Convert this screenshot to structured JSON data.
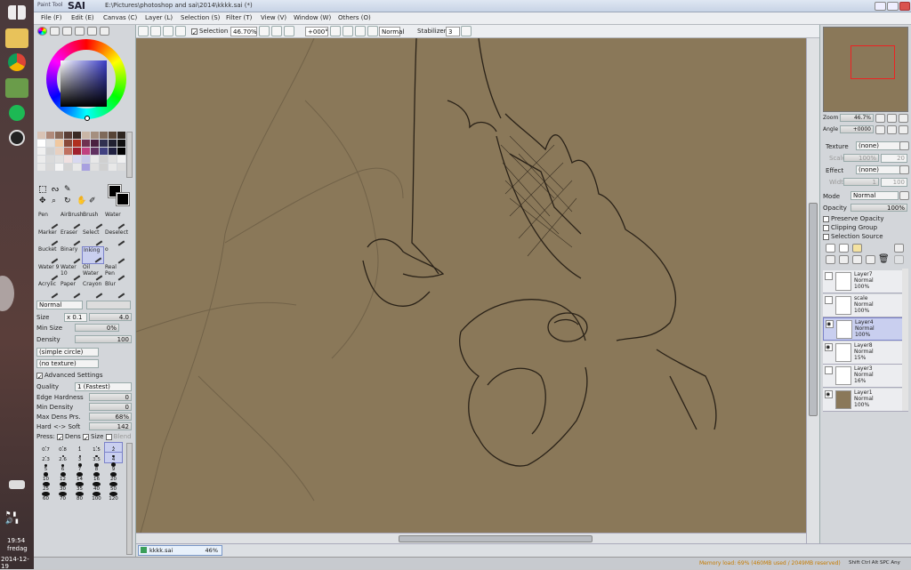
{
  "window": {
    "title": "E:\\Pictures\\photoshop and sai\\2014\\kkkk.sai (*)",
    "logo": "SAI",
    "logo_small": "Paint Tool"
  },
  "menu": [
    "File (F)",
    "Edit (E)",
    "Canvas (C)",
    "Layer (L)",
    "Selection (S)",
    "Filter (T)",
    "View (V)",
    "Window (W)",
    "Others (O)"
  ],
  "toolbar": {
    "selection_label": "Selection",
    "zoom": "46.70%",
    "angle": "+000°",
    "mode": "Normal",
    "stabilizer_label": "Stabilizer",
    "stabilizer": "3"
  },
  "tools": [
    "Pen",
    "AirBrush",
    "Brush",
    "Water",
    "Marker",
    "Eraser",
    "Select",
    "Deselect",
    "Bucket",
    "Binary",
    "Inking",
    "o",
    "Water 9",
    "Water 10",
    "Oil Water",
    "Real Pen",
    "Acrylic",
    "Paper",
    "Crayon",
    "Blur"
  ],
  "tool_props": {
    "mode": "Normal",
    "size_label": "Size",
    "size_mult": "x 0.1",
    "size": "4.0",
    "min_size_label": "Min Size",
    "min_size": "0%",
    "density_label": "Density",
    "density": "100",
    "shape": "(simple circle)",
    "texture": "(no texture)",
    "advanced_label": "Advanced Settings",
    "quality_label": "Quality",
    "quality": "1 (Fastest)",
    "edge_label": "Edge Hardness",
    "edge": "0",
    "min_density_label": "Min Density",
    "min_density": "0",
    "max_dens_label": "Max Dens Prs.",
    "max_dens": "68%",
    "hard_soft_label": "Hard <-> Soft",
    "hard_soft": "142",
    "press_label": "Press:",
    "press_dens": "Dens",
    "press_size": "Size",
    "press_blend": "Blend"
  },
  "brush_sizes": [
    "0.7",
    "0.8",
    "1",
    "1.5",
    "2",
    "2.3",
    "2.6",
    "3",
    "3.5",
    "4",
    "5",
    "6",
    "7",
    "8",
    "9",
    "10",
    "12",
    "14",
    "16",
    "20",
    "25",
    "30",
    "35",
    "40",
    "50",
    "60",
    "70",
    "80",
    "100",
    "120"
  ],
  "navigator": {
    "zoom_label": "Zoom",
    "zoom": "46.7%",
    "angle_label": "Angle",
    "angle": "+0000"
  },
  "layer_props": {
    "texture_label": "Texture",
    "texture": "(none)",
    "scale_label": "Scale",
    "scale": "100%",
    "scale_val": "20",
    "effect_label": "Effect",
    "effect": "(none)",
    "width_label": "Width",
    "width": "1",
    "width_val": "100",
    "mode_label": "Mode",
    "mode": "Normal",
    "opacity_label": "Opacity",
    "opacity": "100%",
    "preserve_opacity": "Preserve Opacity",
    "clipping_group": "Clipping Group",
    "selection_source": "Selection Source"
  },
  "layers": [
    {
      "name": "Layer7",
      "mode": "Normal",
      "opacity": "100%"
    },
    {
      "name": "scale",
      "mode": "Normal",
      "opacity": "100%"
    },
    {
      "name": "Layer4",
      "mode": "Normal",
      "opacity": "100%"
    },
    {
      "name": "Layer8",
      "mode": "Normal",
      "opacity": "15%"
    },
    {
      "name": "Layer3",
      "mode": "Normal",
      "opacity": "16%"
    },
    {
      "name": "Layer1",
      "mode": "Normal",
      "opacity": "100%"
    }
  ],
  "status": {
    "file_tab": "kkkk.sai",
    "file_zoom": "46%",
    "memory": "Memory load: 69% (460MB used / 2049MB reserved)",
    "keys": "Shift Ctrl Alt SPC Any"
  },
  "clock": {
    "time": "19:54",
    "day": "fredag",
    "date": "2014-12-19"
  },
  "colors": {
    "canvas": "#8a7859",
    "accent": "#c9cfef",
    "title": "#dfe7f3"
  }
}
